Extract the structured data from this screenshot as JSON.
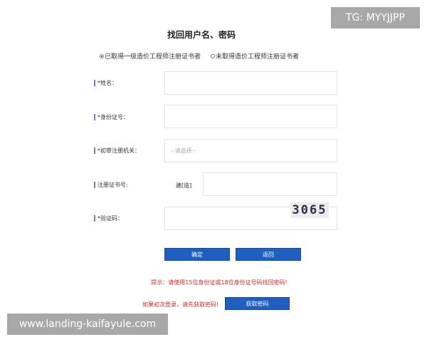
{
  "page": {
    "title": "找回用户名、密码"
  },
  "options": {
    "qualified": "已取得一级造价工程师注册证书者",
    "unqualified": "未取得造价工程师注册证书者",
    "selected": "qualified"
  },
  "form": {
    "name_label": "*姓名：",
    "id_label": "*身份证号：",
    "agency_label": "*初审注册机关：",
    "agency_placeholder": "--请选择--",
    "cert_label": "注册证书号:",
    "cert_prefix": "建[造]",
    "captcha_label": "*验证码：",
    "captcha_text": "3065"
  },
  "buttons": {
    "confirm": "确定",
    "back": "返回",
    "get_password": "获取密码"
  },
  "tips": {
    "hint": "提示：请使用15位身份证或18位身份证号码找回密码!",
    "first_login": "如果初次登录，请先获取密码!"
  },
  "watermarks": {
    "tg": "TG: MYYJJPP",
    "url": "www.landing-kaifayule.com"
  }
}
